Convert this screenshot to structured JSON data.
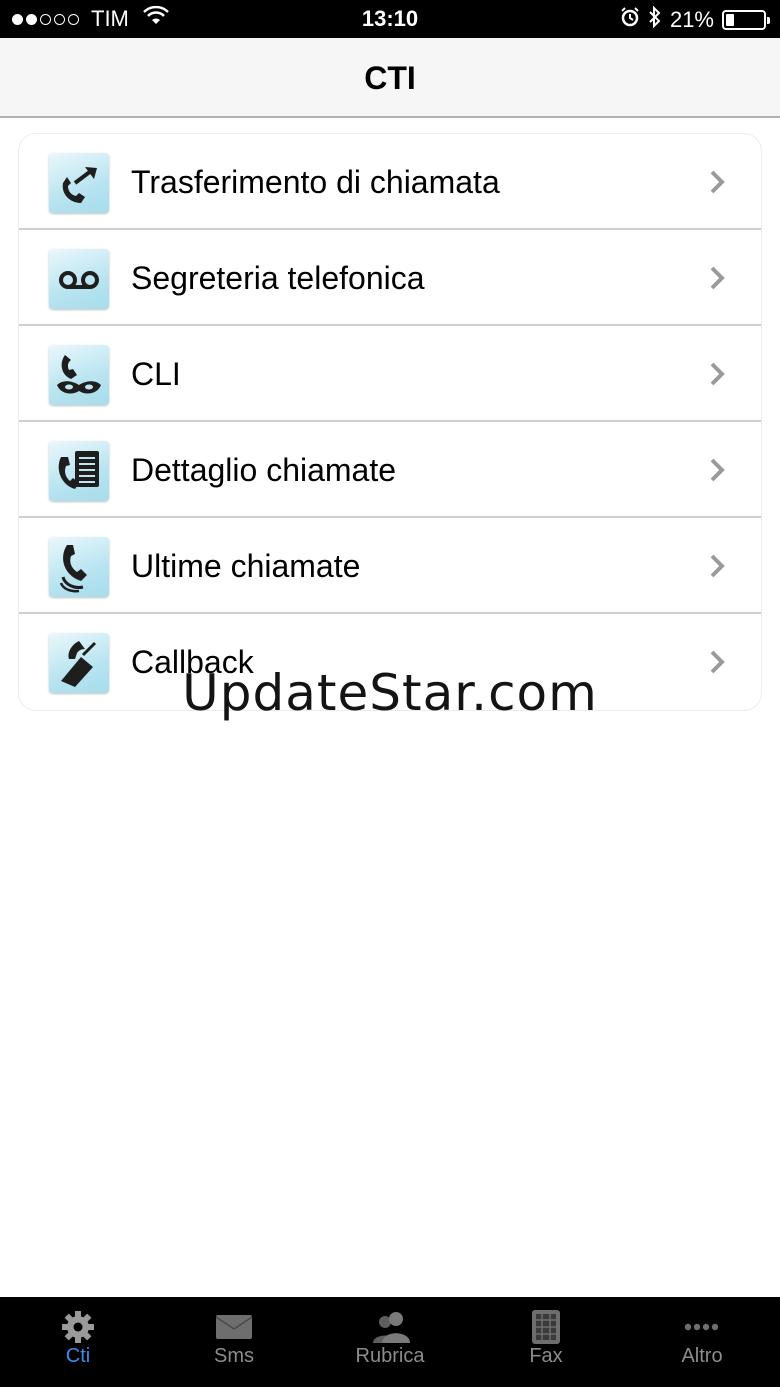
{
  "status_bar": {
    "signal_filled": 2,
    "signal_total": 5,
    "carrier": "TIM",
    "time": "13:10",
    "battery_percent": "21%",
    "battery_level": 0.21,
    "icons": [
      "wifi-icon",
      "alarm-icon",
      "bluetooth-icon",
      "battery-icon"
    ]
  },
  "nav": {
    "title": "CTI"
  },
  "menu": {
    "items": [
      {
        "label": "Trasferimento di chiamata",
        "icon": "call-transfer-icon"
      },
      {
        "label": "Segreteria telefonica",
        "icon": "voicemail-icon"
      },
      {
        "label": "CLI",
        "icon": "masked-caller-icon"
      },
      {
        "label": "Dettaglio chiamate",
        "icon": "call-detail-icon"
      },
      {
        "label": "Ultime chiamate",
        "icon": "recent-calls-icon"
      },
      {
        "label": "Callback",
        "icon": "callback-icon"
      }
    ],
    "chevron_icon": "chevron-right-icon"
  },
  "watermark": "UpdateStar.com",
  "tabs": [
    {
      "label": "Cti",
      "icon": "gear-icon",
      "active": true
    },
    {
      "label": "Sms",
      "icon": "envelope-icon",
      "active": false
    },
    {
      "label": "Rubrica",
      "icon": "contacts-icon",
      "active": false
    },
    {
      "label": "Fax",
      "icon": "fax-icon",
      "active": false
    },
    {
      "label": "Altro",
      "icon": "more-icon",
      "active": false
    }
  ],
  "colors": {
    "active_tab": "#3a8be8",
    "inactive_tab": "#8c8c8c",
    "icon_tile": "#b8e4f0"
  }
}
